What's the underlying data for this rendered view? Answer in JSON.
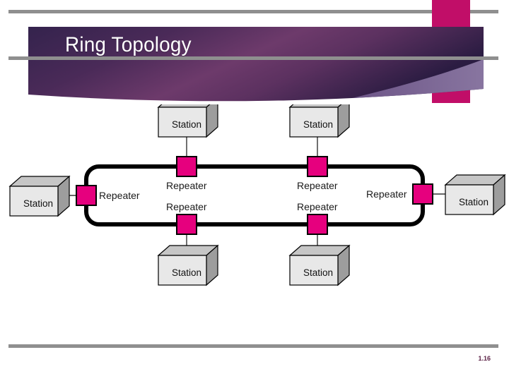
{
  "slide": {
    "title": "Ring Topology",
    "footer_number": "1.16",
    "colors": {
      "accent_magenta": "#c10e68",
      "banner_purple_dark": "#2e1f47",
      "banner_purple_light": "#7a4a76",
      "rule_gray": "#8f8f8f",
      "footer_text": "#5c2246",
      "repeater_fill": "#e6007e",
      "station_face": "#e3e3e3",
      "station_top": "#b9b9b9",
      "station_side": "#9a9a9a",
      "ring_line": "#000000"
    }
  },
  "diagram": {
    "name": "ring-topology-network-diagram",
    "stations": [
      {
        "id": "station-top-left",
        "label": "Station"
      },
      {
        "id": "station-top-right",
        "label": "Station"
      },
      {
        "id": "station-left",
        "label": "Station"
      },
      {
        "id": "station-right",
        "label": "Station"
      },
      {
        "id": "station-bottom-left",
        "label": "Station"
      },
      {
        "id": "station-bottom-right",
        "label": "Station"
      }
    ],
    "repeaters": [
      {
        "id": "repeater-top-left",
        "label": "Repeater"
      },
      {
        "id": "repeater-top-right",
        "label": "Repeater"
      },
      {
        "id": "repeater-left",
        "label": "Repeater"
      },
      {
        "id": "repeater-right",
        "label": "Repeater"
      },
      {
        "id": "repeater-bottom-left",
        "label": "Repeater"
      },
      {
        "id": "repeater-bottom-right",
        "label": "Repeater"
      }
    ]
  }
}
